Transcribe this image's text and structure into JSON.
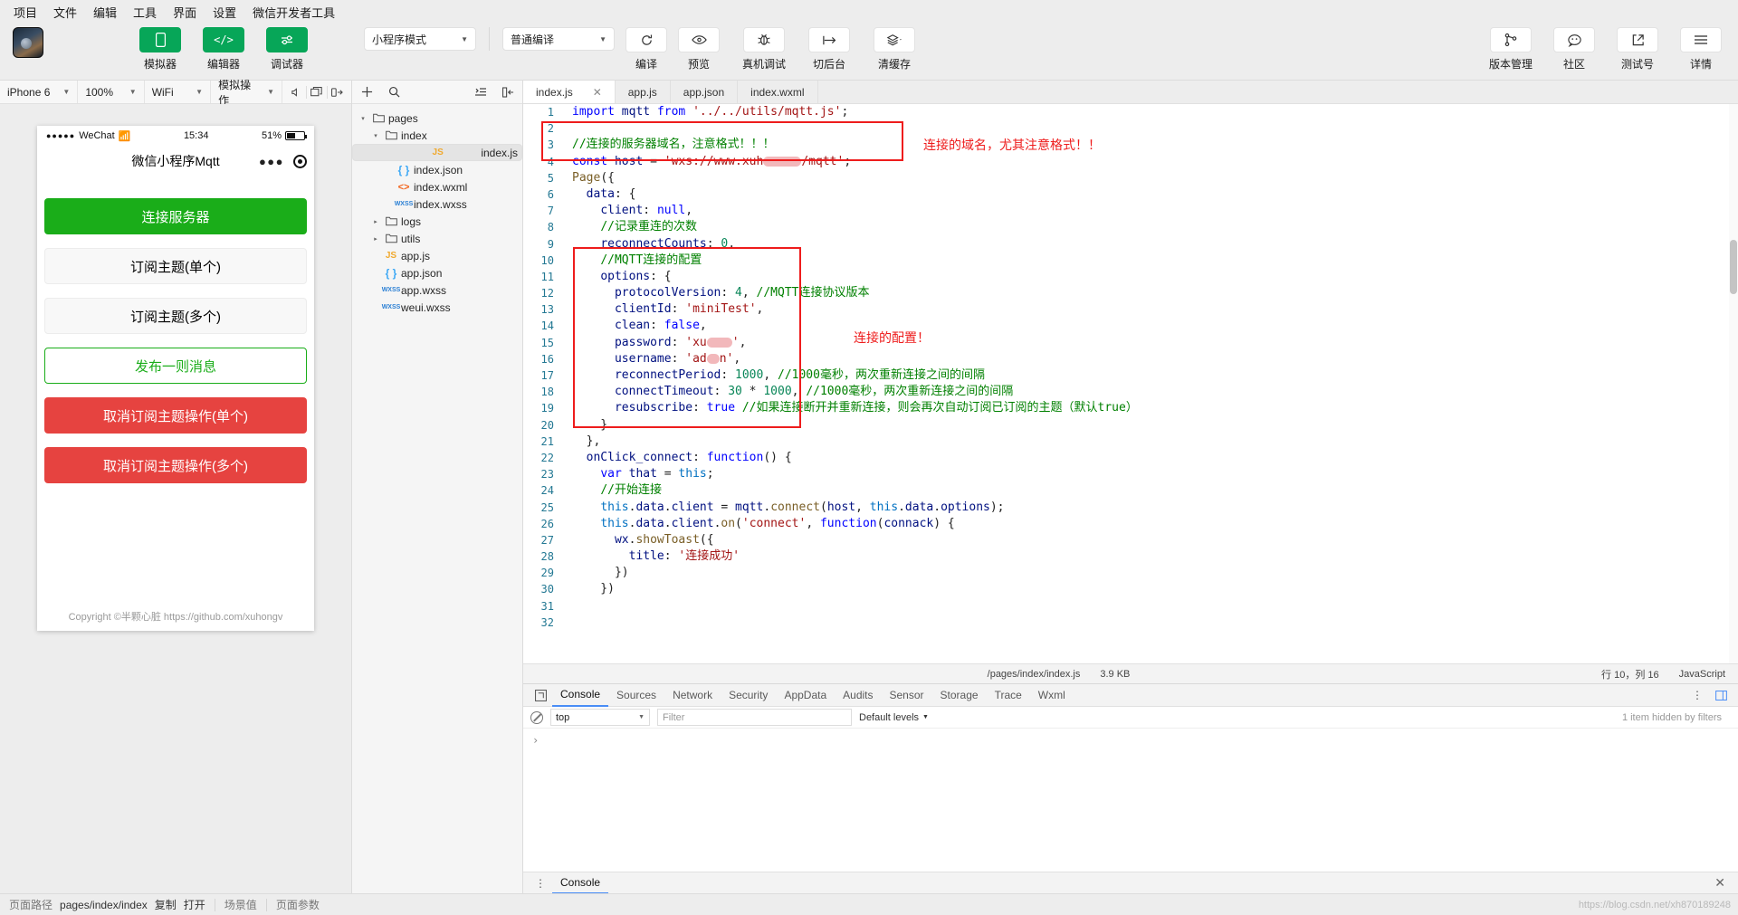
{
  "menubar": {
    "items": [
      "项目",
      "文件",
      "编辑",
      "工具",
      "界面",
      "设置",
      "微信开发者工具"
    ]
  },
  "toolbar": {
    "panel_buttons": [
      {
        "label": "模拟器",
        "icon": "phone-icon"
      },
      {
        "label": "编辑器",
        "icon": "code-icon"
      },
      {
        "label": "调试器",
        "icon": "sliders-icon"
      }
    ],
    "mode_select": "小程序模式",
    "compile_select": "普通编译",
    "actions": [
      {
        "label": "编译",
        "icon": "refresh-icon"
      },
      {
        "label": "预览",
        "icon": "eye-icon"
      },
      {
        "label": "真机调试",
        "icon": "bug-icon"
      },
      {
        "label": "切后台",
        "icon": "background-icon"
      },
      {
        "label": "清缓存",
        "icon": "layers-icon"
      }
    ],
    "right_actions": [
      {
        "label": "版本管理",
        "icon": "branch-icon"
      },
      {
        "label": "社区",
        "icon": "chat-icon"
      },
      {
        "label": "测试号",
        "icon": "external-link-icon"
      },
      {
        "label": "详情",
        "icon": "menu-icon"
      }
    ]
  },
  "simulator": {
    "controls": [
      {
        "label": "iPhone 6"
      },
      {
        "label": "100%"
      },
      {
        "label": "WiFi"
      },
      {
        "label": "模拟操作"
      }
    ],
    "icons": [
      "volume-icon",
      "window-icon",
      "rotate-icon"
    ],
    "phone": {
      "carrier": "WeChat",
      "time": "15:34",
      "battery": "51%",
      "title": "微信小程序Mqtt",
      "buttons": [
        {
          "label": "连接服务器",
          "style": "primary"
        },
        {
          "label": "订阅主题(单个)",
          "style": "default"
        },
        {
          "label": "订阅主题(多个)",
          "style": "default"
        },
        {
          "label": "发布一则消息",
          "style": "ghost"
        },
        {
          "label": "取消订阅主题操作(单个)",
          "style": "warn"
        },
        {
          "label": "取消订阅主题操作(多个)",
          "style": "warn"
        }
      ],
      "copyright": "Copyright ©半颗心脏 https://github.com/xuhongv"
    }
  },
  "filetree": {
    "toolbar_icons": [
      "add-icon",
      "search-icon",
      "collapse-icon",
      "sidebar-icon"
    ],
    "nodes": [
      {
        "label": "pages",
        "depth": 0,
        "type": "folder",
        "twisty": "▾"
      },
      {
        "label": "index",
        "depth": 1,
        "type": "folder",
        "twisty": "▾"
      },
      {
        "label": "index.js",
        "depth": 2,
        "type": "js",
        "selected": true
      },
      {
        "label": "index.json",
        "depth": 2,
        "type": "json"
      },
      {
        "label": "index.wxml",
        "depth": 2,
        "type": "wxml"
      },
      {
        "label": "index.wxss",
        "depth": 2,
        "type": "wxss"
      },
      {
        "label": "logs",
        "depth": 1,
        "type": "folder",
        "twisty": "▸"
      },
      {
        "label": "utils",
        "depth": 1,
        "type": "folder",
        "twisty": "▸"
      },
      {
        "label": "app.js",
        "depth": 1,
        "type": "js"
      },
      {
        "label": "app.json",
        "depth": 1,
        "type": "json"
      },
      {
        "label": "app.wxss",
        "depth": 1,
        "type": "wxss"
      },
      {
        "label": "weui.wxss",
        "depth": 1,
        "type": "wxss"
      }
    ]
  },
  "editor": {
    "tabs": [
      {
        "label": "index.js",
        "active": true,
        "closable": true
      },
      {
        "label": "app.js",
        "active": false
      },
      {
        "label": "app.json",
        "active": false
      },
      {
        "label": "index.wxml",
        "active": false
      }
    ],
    "lines": [
      {
        "n": 1,
        "text": "import mqtt from '../../utils/mqtt.js';"
      },
      {
        "n": 2,
        "text": ""
      },
      {
        "n": 3,
        "text": "//连接的服务器域名，注意格式！！！"
      },
      {
        "n": 4,
        "text": "const host = 'wxs://www.xuh______/mqtt';"
      },
      {
        "n": 5,
        "text": "Page({"
      },
      {
        "n": 6,
        "text": "  data: {"
      },
      {
        "n": 7,
        "text": "    client: null,"
      },
      {
        "n": 8,
        "text": "    //记录重连的次数"
      },
      {
        "n": 9,
        "text": "    reconnectCounts: 0,"
      },
      {
        "n": 10,
        "text": "    //MQTT连接的配置"
      },
      {
        "n": 11,
        "text": "    options: {"
      },
      {
        "n": 12,
        "text": "      protocolVersion: 4, //MQTT连接协议版本"
      },
      {
        "n": 13,
        "text": "      clientId: 'miniTest',"
      },
      {
        "n": 14,
        "text": "      clean: false,"
      },
      {
        "n": 15,
        "text": "      password: 'xu____',"
      },
      {
        "n": 16,
        "text": "      username: 'ad__n',"
      },
      {
        "n": 17,
        "text": "      reconnectPeriod: 1000, //1000毫秒，两次重新连接之间的间隔"
      },
      {
        "n": 18,
        "text": "      connectTimeout: 30 * 1000, //1000毫秒，两次重新连接之间的间隔"
      },
      {
        "n": 19,
        "text": "      resubscribe: true //如果连接断开并重新连接，则会再次自动订阅已订阅的主题（默认true）"
      },
      {
        "n": 20,
        "text": "    }"
      },
      {
        "n": 21,
        "text": "  },"
      },
      {
        "n": 22,
        "text": "  onClick_connect: function() {"
      },
      {
        "n": 23,
        "text": "    var that = this;"
      },
      {
        "n": 24,
        "text": "    //开始连接"
      },
      {
        "n": 25,
        "text": "    this.data.client = mqtt.connect(host, this.data.options);"
      },
      {
        "n": 26,
        "text": "    this.data.client.on('connect', function(connack) {"
      },
      {
        "n": 27,
        "text": "      wx.showToast({"
      },
      {
        "n": 28,
        "text": "        title: '连接成功'"
      },
      {
        "n": 29,
        "text": "      })"
      },
      {
        "n": 30,
        "text": "    })"
      },
      {
        "n": 31,
        "text": ""
      },
      {
        "n": 32,
        "text": ""
      }
    ],
    "annotations": [
      {
        "text": "连接的域名，尤其注意格式！！",
        "color": "#ee1c1c"
      },
      {
        "text": "连接的配置！",
        "color": "#ee1c1c"
      }
    ],
    "status": {
      "path": "/pages/index/index.js",
      "size": "3.9 KB",
      "cursor": "行 10，列 16",
      "language": "JavaScript"
    }
  },
  "devtools": {
    "tabs": [
      "Console",
      "Sources",
      "Network",
      "Security",
      "AppData",
      "Audits",
      "Sensor",
      "Storage",
      "Trace",
      "Wxml"
    ],
    "active_tab": "Console",
    "context": "top",
    "filter_placeholder": "Filter",
    "levels": "Default levels",
    "hidden_note": "1 item hidden by filters",
    "prompt": "›",
    "footer_tab": "Console"
  },
  "statusbar": {
    "page_path_label": "页面路径",
    "page_path_value": "pages/index/index",
    "copy_label": "复制",
    "open_label": "打开",
    "scene_label": "场景值",
    "params_label": "页面参数",
    "watermark": "https://blog.csdn.net/xh870189248"
  }
}
